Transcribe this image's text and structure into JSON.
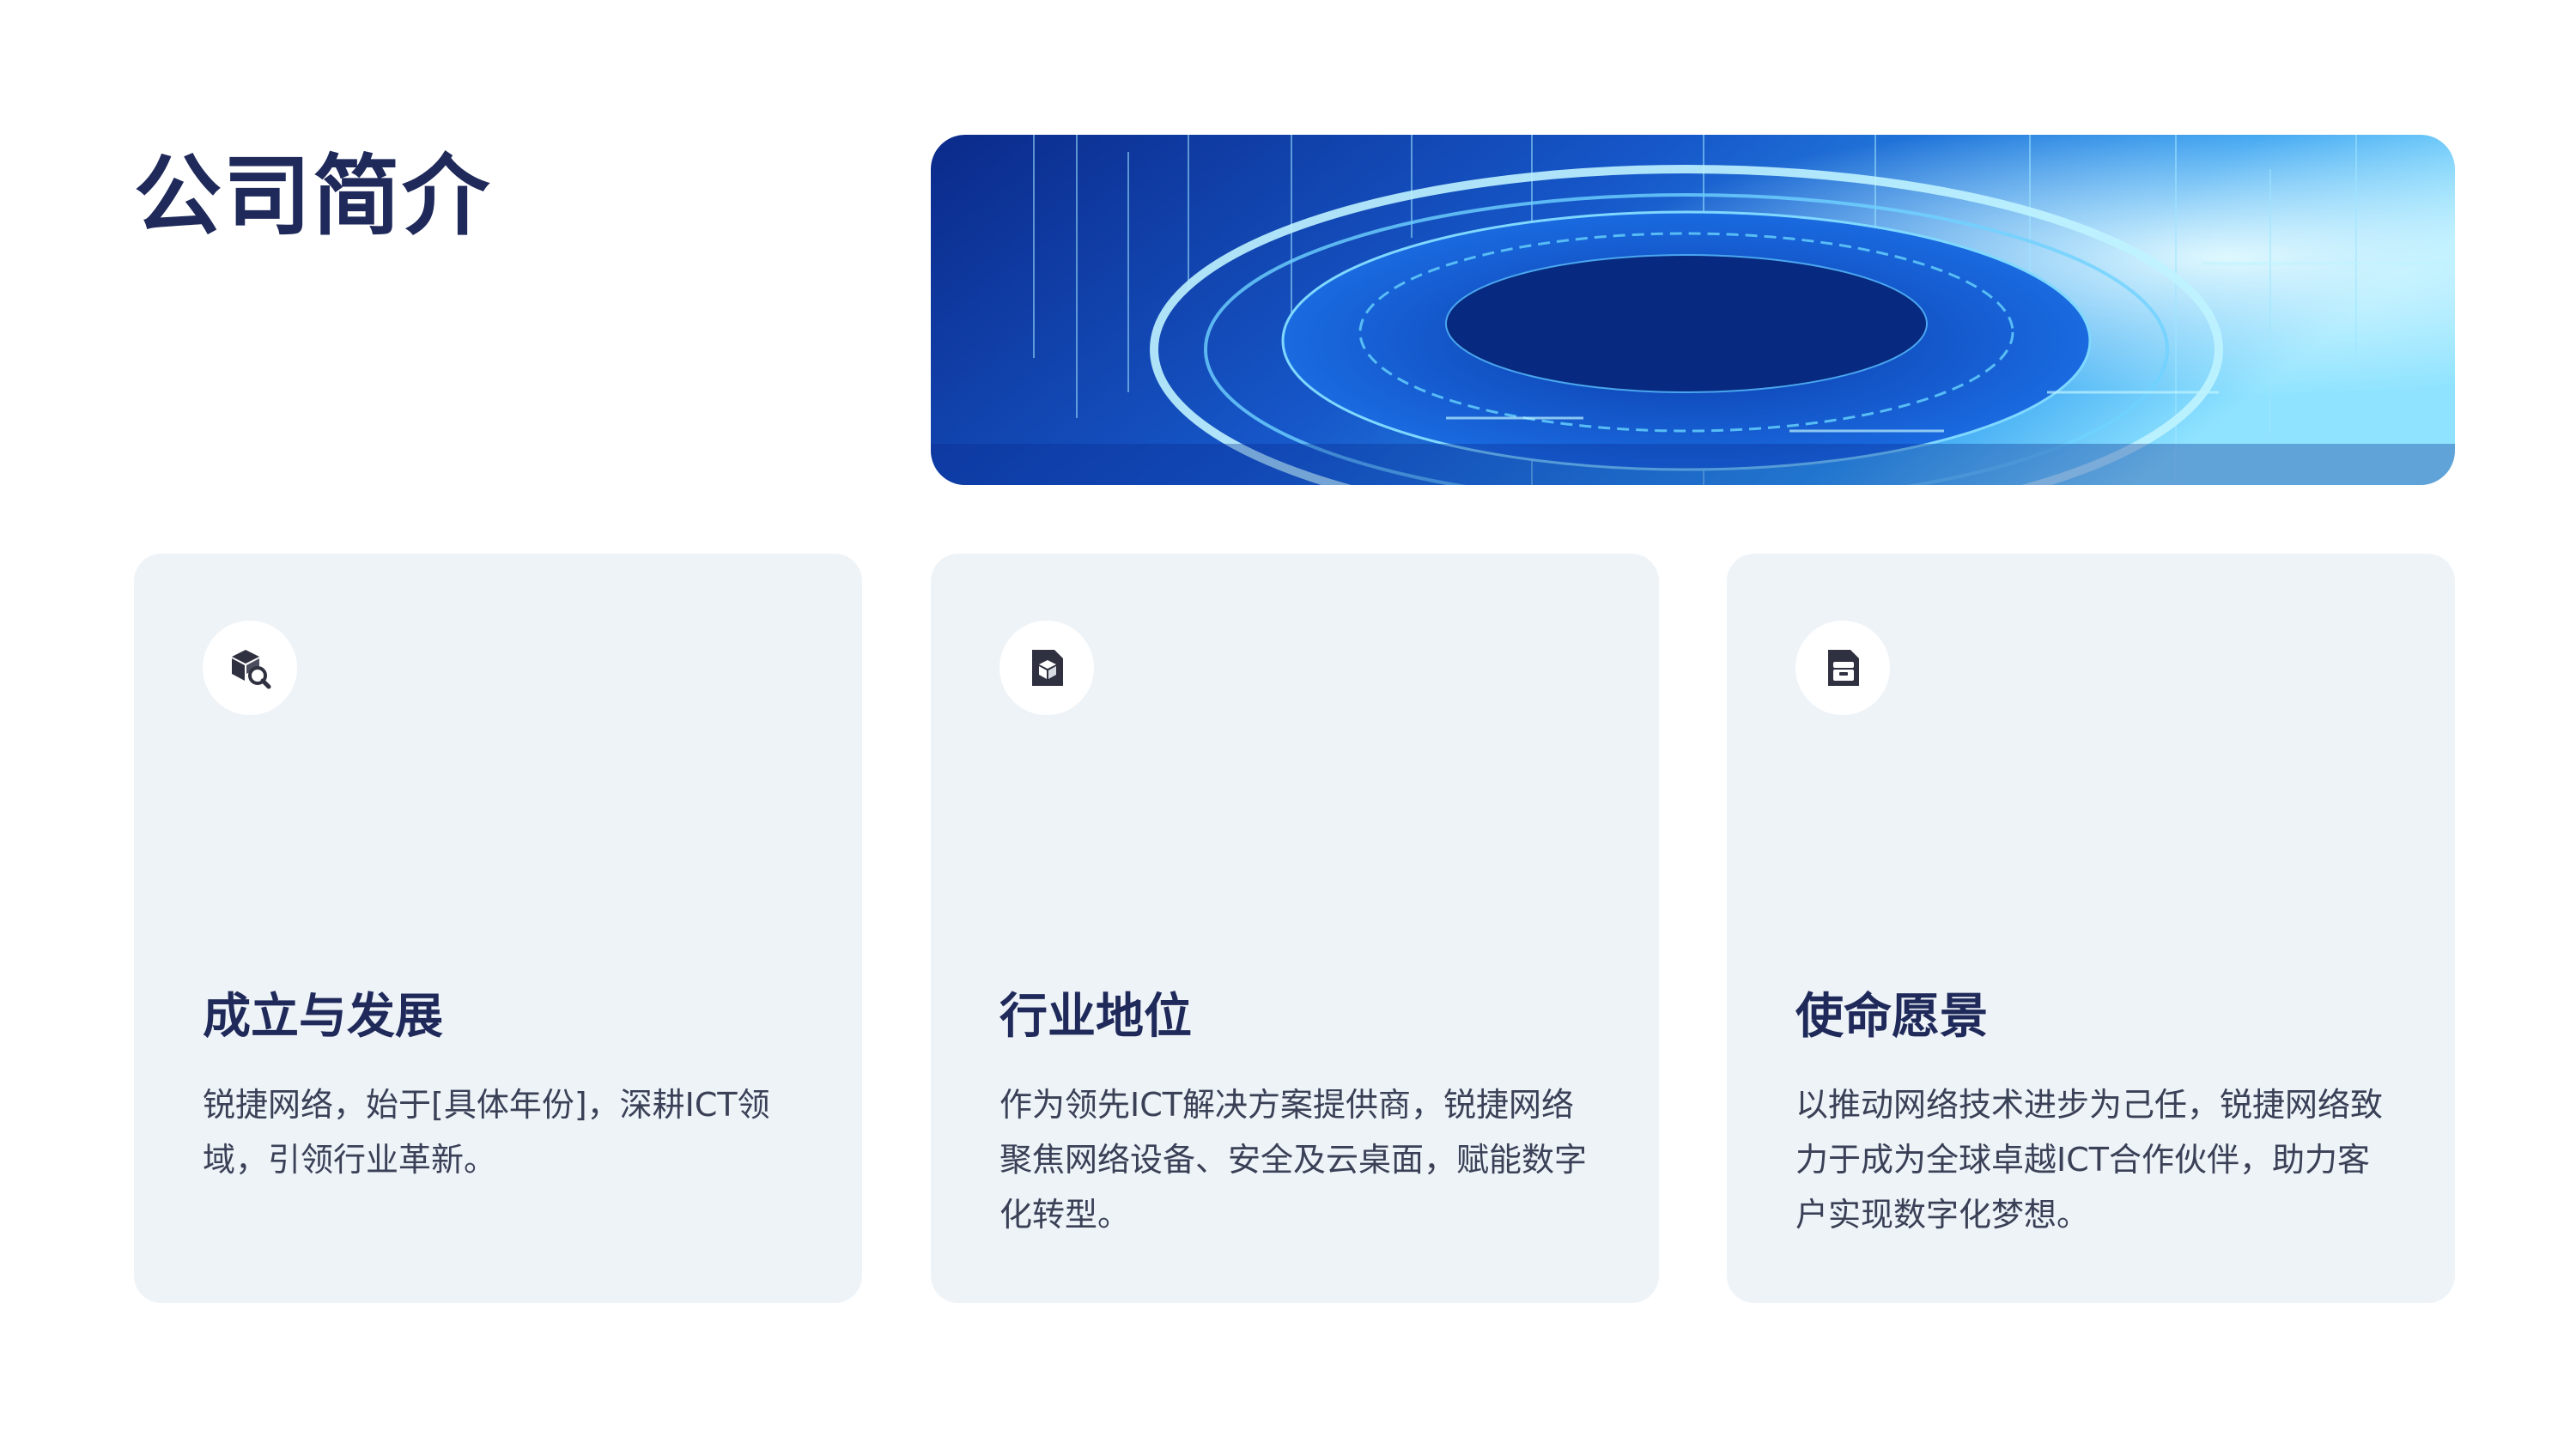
{
  "page": {
    "title": "公司简介"
  },
  "hero": {
    "image": "futuristic-blue-circuit-ring",
    "colors": {
      "deep": "#0b2a8a",
      "mid": "#1f6fe0",
      "glow": "#7fd8ff"
    }
  },
  "cards": [
    {
      "icon": "box-search-icon",
      "title": "成立与发展",
      "body": "锐捷网络，始于[具体年份]，深耕ICT领域，引领行业革新。"
    },
    {
      "icon": "box-document-icon",
      "title": "行业地位",
      "body": "作为领先ICT解决方案提供商，锐捷网络聚焦网络设备、安全及云桌面，赋能数字化转型。"
    },
    {
      "icon": "archive-document-icon",
      "title": "使命愿景",
      "body": "以推动网络技术进步为己任，锐捷网络致力于成为全球卓越ICT合作伙伴，助力客户实现数字化梦想。"
    }
  ],
  "theme": {
    "title_color": "#1f2a5a",
    "card_bg": "#eef3f8",
    "body_color": "#3a4056"
  }
}
